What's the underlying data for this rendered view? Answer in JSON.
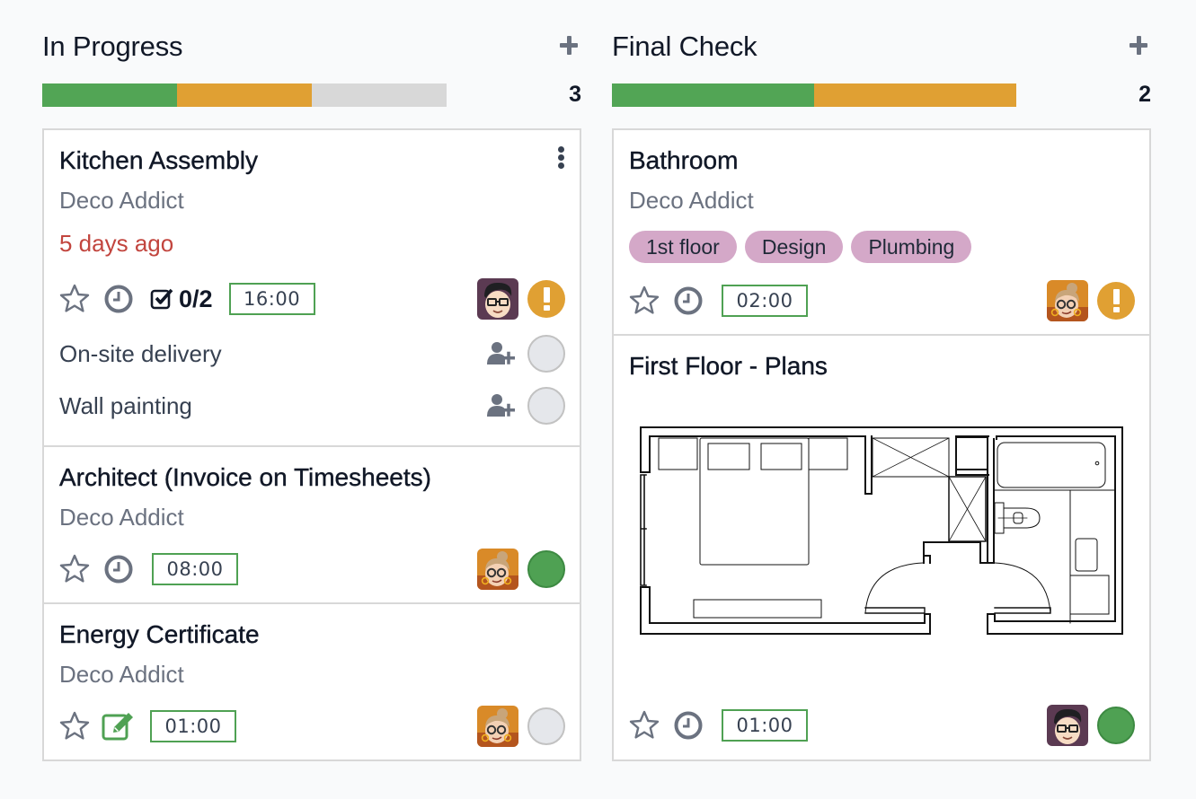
{
  "columns": [
    {
      "title": "In Progress",
      "count": "3",
      "progress": [
        {
          "status": "done",
          "fraction": 0.3333,
          "color": "#52a555"
        },
        {
          "status": "warning",
          "fraction": 0.3333,
          "color": "#e0a033"
        },
        {
          "status": "none",
          "fraction": 0.3334,
          "color": "#d8d8d8"
        }
      ],
      "cards": [
        {
          "title": "Kitchen Assembly",
          "customer": "Deco Addict",
          "deadline": "5 days ago",
          "checklist": "0/2",
          "time": "16:00",
          "assignee": "man-avatar",
          "status": "warning",
          "subtasks": [
            {
              "label": "On-site delivery",
              "status": "none"
            },
            {
              "label": "Wall painting",
              "status": "none"
            }
          ]
        },
        {
          "title": "Architect (Invoice on Timesheets)",
          "customer": "Deco Addict",
          "time": "08:00",
          "assignee": "woman-avatar",
          "status": "done"
        },
        {
          "title": "Energy Certificate",
          "customer": "Deco Addict",
          "time": "01:00",
          "assignee": "woman-avatar",
          "status": "none",
          "activity_icon": "edit-icon"
        }
      ]
    },
    {
      "title": "Final Check",
      "count": "2",
      "progress": [
        {
          "status": "done",
          "fraction": 0.5,
          "color": "#52a555"
        },
        {
          "status": "warning",
          "fraction": 0.5,
          "color": "#e0a033"
        }
      ],
      "cards": [
        {
          "title": "Bathroom",
          "customer": "Deco Addict",
          "tags": [
            "1st floor",
            "Design",
            "Plumbing"
          ],
          "time": "02:00",
          "assignee": "woman-avatar",
          "status": "warning"
        },
        {
          "title": "First Floor - Plans",
          "cover_image": "floor-plan-drawing",
          "time": "01:00",
          "assignee": "man-avatar",
          "status": "done"
        }
      ]
    }
  ],
  "colors": {
    "done": "#52a555",
    "warning": "#e0a033",
    "deadline_overdue": "#c2453e",
    "tag": "#d4a8c8",
    "time_badge_border": "#4fa153"
  }
}
